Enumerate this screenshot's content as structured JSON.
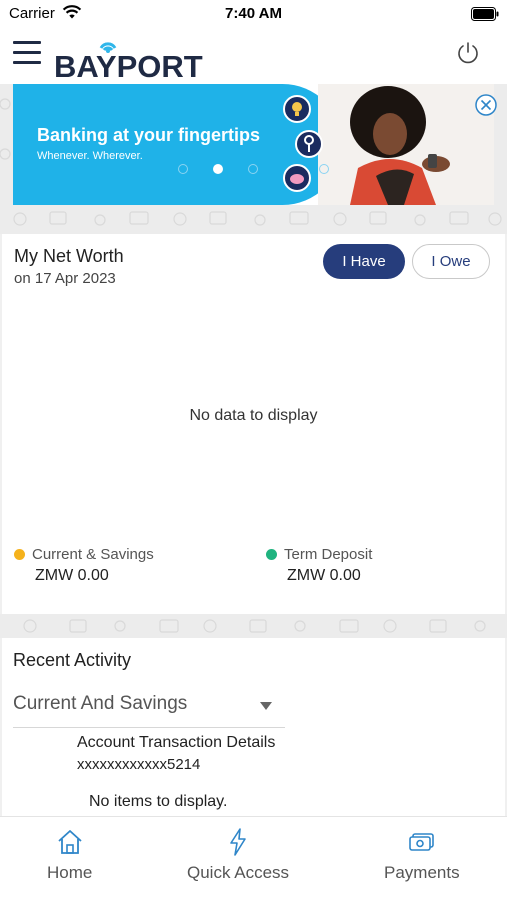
{
  "status_bar": {
    "carrier": "Carrier",
    "time": "7:40 AM"
  },
  "header": {
    "logo_text": "BAYPORT",
    "logo_icon": "wifi-arc-logo",
    "menu_icon": "hamburger-icon",
    "power_icon": "power-icon"
  },
  "banner": {
    "headline": "Banking at your fingertips",
    "subtext": "Whenever. Wherever.",
    "slide_count": 4,
    "active_slide": 2,
    "close_icon": "close-circle-icon",
    "colors": {
      "blue": "#1fb2e8",
      "badge": "#1a2b5f"
    }
  },
  "net_worth": {
    "title": "My Net Worth",
    "date": "on 17 Apr 2023",
    "tab_have": "I Have",
    "tab_owe": "I Owe",
    "active_tab": "I Have",
    "empty_message": "No data to display",
    "legend": [
      {
        "label": "Current & Savings",
        "amount": "ZMW 0.00",
        "color": "#f5b21c"
      },
      {
        "label": "Term Deposit",
        "amount": "ZMW 0.00",
        "color": "#1fb37f"
      }
    ]
  },
  "recent_activity": {
    "title": "Recent Activity",
    "selected_account_type": "Current And Savings",
    "detail_title": "Account Transaction Details",
    "account_number": "xxxxxxxxxxxx5214",
    "empty_message": "No items to display."
  },
  "bottom_nav": {
    "items": [
      {
        "label": "Home",
        "icon": "home-icon"
      },
      {
        "label": "Quick Access",
        "icon": "lightning-icon"
      },
      {
        "label": "Payments",
        "icon": "cash-icon"
      }
    ],
    "icon_color": "#2f86c9"
  }
}
